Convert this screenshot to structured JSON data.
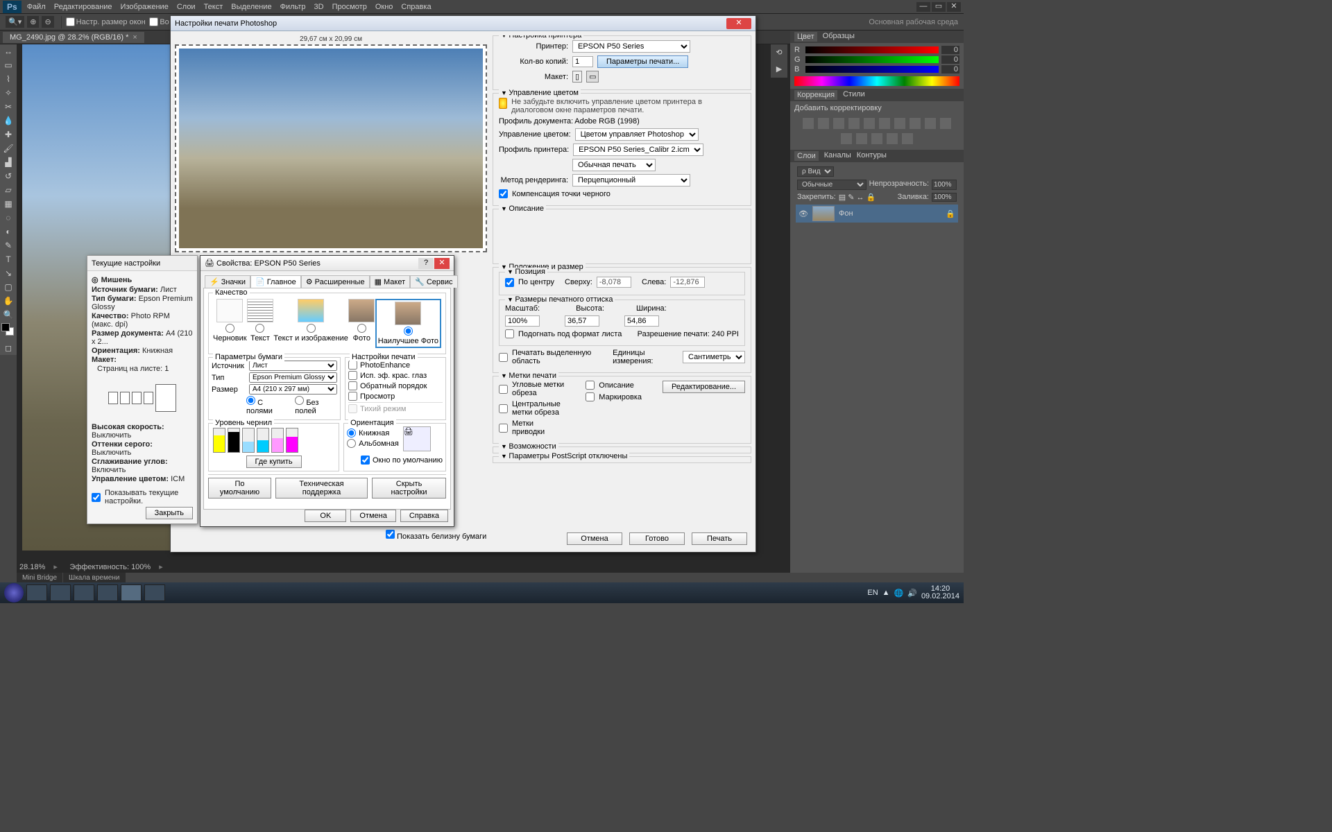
{
  "menu": [
    "Файл",
    "Редактирование",
    "Изображение",
    "Слои",
    "Текст",
    "Выделение",
    "Фильтр",
    "3D",
    "Просмотр",
    "Окно",
    "Справка"
  ],
  "optbar": {
    "opt1": "Настр. размер окон",
    "opt2": "Во всех окн",
    "ws": "Основная рабочая среда"
  },
  "doc_tab": "MG_2490.jpg @ 28.2% (RGB/16) *",
  "status": {
    "zoom": "28.18%",
    "eff": "Эффективность: 100%"
  },
  "minitabs": [
    "Mini Bridge",
    "Шкала времени"
  ],
  "color": {
    "tab1": "Цвет",
    "tab2": "Образцы",
    "r": "R",
    "g": "G",
    "b": "B",
    "rv": "0",
    "gv": "0",
    "bv": "0"
  },
  "adj": {
    "tab1": "Коррекция",
    "tab2": "Стили",
    "add": "Добавить корректировку"
  },
  "lay": {
    "tab1": "Слои",
    "tab2": "Каналы",
    "tab3": "Контуры",
    "kind": "ρ Вид",
    "mode": "Обычные",
    "op": "Непрозрачность:",
    "opv": "100%",
    "lock": "Закрепить:",
    "fill": "Заливка:",
    "fillv": "100%",
    "name": "Фон"
  },
  "print": {
    "title": "Настройки печати Photoshop",
    "dim": "29,67 см x 20,99 см",
    "s_printer": "Настройка принтера",
    "l_printer": "Принтер:",
    "v_printer": "EPSON P50 Series",
    "l_copies": "Кол-во копий:",
    "v_copies": "1",
    "btn_prset": "Параметры печати...",
    "l_layout": "Макет:",
    "s_cm": "Управление цветом",
    "cm_warn": "Не забудьте включить управление цветом принтера в диалоговом окне параметров печати.",
    "l_docprof": "Профиль документа:",
    "v_docprof": "Adobe RGB (1998)",
    "l_handle": "Управление цветом:",
    "v_handle": "Цветом управляет Photoshop",
    "l_prprof": "Профиль принтера:",
    "v_prprof": "EPSON P50 Series_Calibr 2.icm",
    "v_normal": "Обычная печать",
    "l_intent": "Метод рендеринга:",
    "v_intent": "Перцепционный",
    "chk_bpc": "Компенсация точки черного",
    "s_desc": "Описание",
    "s_pos": "Положение и размер",
    "fs_pos": "Позиция",
    "chk_center": "По центру",
    "l_top": "Сверху:",
    "v_top": "-8,078",
    "l_left": "Слева:",
    "v_left": "-12,876",
    "fs_size": "Размеры печатного оттиска",
    "l_scale": "Масштаб:",
    "v_scale": "100%",
    "l_h": "Высота:",
    "v_h": "36,57",
    "l_w": "Ширина:",
    "v_w": "54,86",
    "chk_fit": "Подогнать под формат листа",
    "l_res": "Разрешение печати: 240 PPI",
    "chk_selonly": "Печатать выделенную область",
    "l_units": "Единицы измерения:",
    "v_units": "Сантиметры",
    "s_marks": "Метки печати",
    "m1": "Угловые метки обреза",
    "m2": "Центральные метки обреза",
    "m3": "Метки приводки",
    "m4": "Описание",
    "m5": "Маркировка",
    "btn_edit": "Редактирование...",
    "s_opts": "Возможности",
    "s_ps": "Параметры PostScript отключены",
    "chk_white": "Показать белизну бумаги",
    "btn_cancel": "Отмена",
    "btn_done": "Готово",
    "btn_print": "Печать"
  },
  "eps": {
    "title": "Свойства: EPSON P50 Series",
    "tabs": [
      "Значки",
      "Главное",
      "Расширенные",
      "Макет",
      "Сервис"
    ],
    "s_qual": "Качество",
    "q": [
      "Черновик",
      "Текст",
      "Текст и изображение",
      "Фото",
      "Наилучшее Фото"
    ],
    "s_paper": "Параметры бумаги",
    "l_src": "Источник",
    "v_src": "Лист",
    "l_type": "Тип",
    "v_type": "Epson Premium Glossy",
    "l_size": "Размер",
    "v_size": "A4 (210 x 297 мм)",
    "r_border": "С полями",
    "r_bless": "Без полей",
    "s_popts": "Настройки печати",
    "c1": "PhotoEnhance",
    "c2": "Исп. эф. крас. глаз",
    "c3": "Обратный порядок",
    "c4": "Просмотр",
    "c5": "Тихий режим",
    "s_ink": "Уровень чернил",
    "btn_buy": "Где купить",
    "s_orient": "Ориентация",
    "o1": "Книжная",
    "o2": "Альбомная",
    "chk_def": "Окно по умолчанию",
    "b_def": "По умолчанию",
    "b_tech": "Техническая поддержка",
    "b_hide": "Скрыть настройки",
    "b_ok": "OK",
    "b_cancel": "Отмена",
    "b_help": "Справка"
  },
  "cur": {
    "title": "Текущие настройки",
    "target": "Мишень",
    "l1": "Источник бумаги:",
    "v1": "Лист",
    "l2": "Тип бумаги:",
    "v2": "Epson Premium Glossy",
    "l3": "Качество:",
    "v3": "Photo RPM (макс. dpi)",
    "l4": "Размер документа:",
    "v4": "A4 (210 x 2...",
    "l5": "Ориентация:",
    "v5": "Книжная",
    "l6": "Макет:",
    "l7": "Страниц на листе:",
    "v7": "1",
    "l8": "Высокая скорость:",
    "v8": "Выключить",
    "l9": "Оттенки серого:",
    "v9": "Выключить",
    "l10": "Сглаживание углов:",
    "v10": "Включить",
    "l11": "Управление цветом:",
    "v11": "ICM",
    "chk": "Показывать текущие настройки.",
    "btn": "Закрыть"
  },
  "task": {
    "lang": "EN",
    "time": "14:20",
    "date": "09.02.2014"
  }
}
